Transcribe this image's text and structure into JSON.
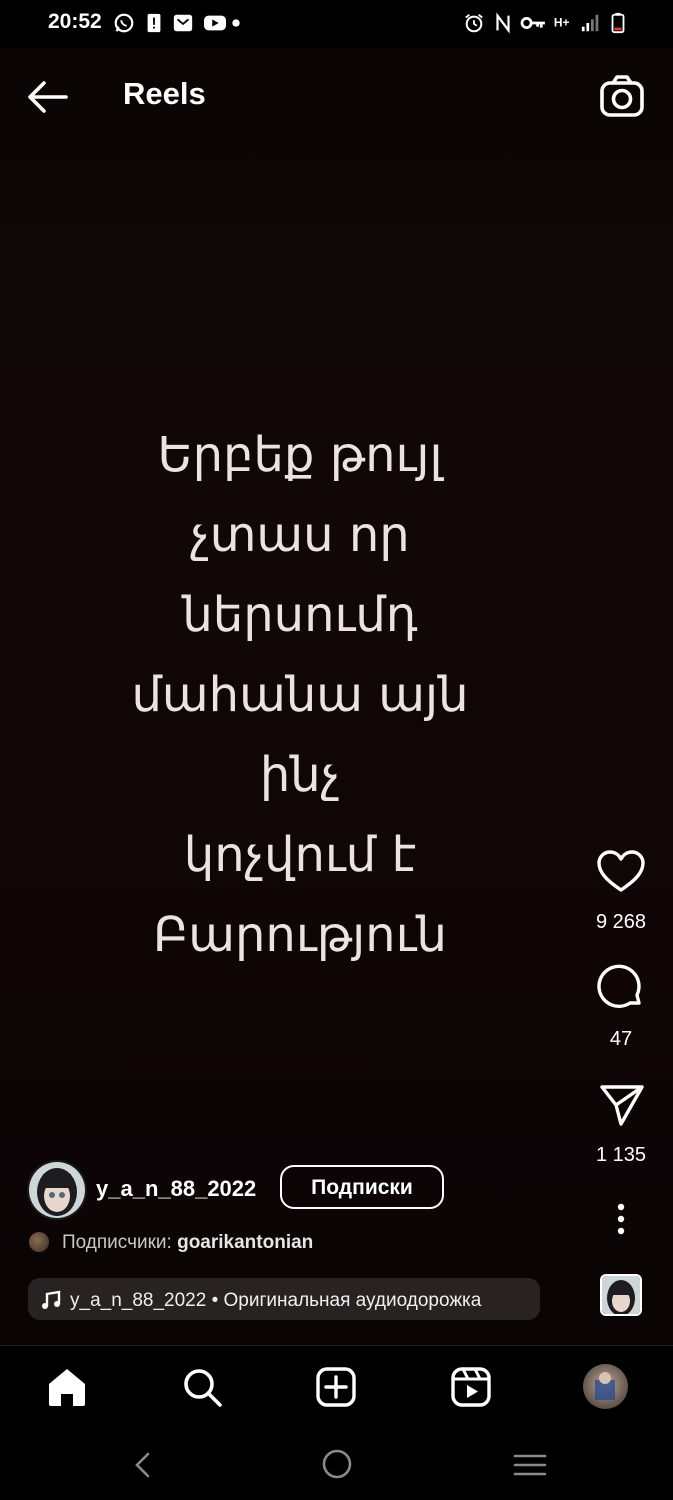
{
  "status_bar": {
    "time": "20:52",
    "left_icons": [
      "whatsapp-icon",
      "alert-icon",
      "mail-icon",
      "youtube-icon",
      "dot-icon"
    ],
    "right_icons": [
      "alarm-icon",
      "nfc-icon",
      "key-icon",
      "network-hplus-icon",
      "signal-icon",
      "battery-icon"
    ]
  },
  "header": {
    "title": "Reels",
    "back_icon": "arrow-left-icon",
    "camera_icon": "camera-icon"
  },
  "video": {
    "caption_lines": [
      "Երբեք թույլ",
      "չտաս որ",
      "ներսումդ",
      "մահանա այն",
      "ինչ",
      "կոչվում է",
      "Բարություն"
    ]
  },
  "actions": {
    "likes": "9 268",
    "comments": "47",
    "shares": "1 135"
  },
  "author": {
    "username": "y_a_n_88_2022",
    "follow_label": "Подписки",
    "followers_prefix": "Подписчики:",
    "followers_name": "goarikantonian"
  },
  "audio": {
    "label": "y_a_n_88_2022 • Оригинальная аудиодорожка"
  },
  "bottom_nav": {
    "items": [
      "home-icon",
      "search-icon",
      "create-icon",
      "reels-icon",
      "profile-avatar"
    ]
  },
  "colors": {
    "background": "#000000",
    "video_bg": "#120708",
    "text": "#ffffff",
    "caption": "#e9e4e2"
  }
}
